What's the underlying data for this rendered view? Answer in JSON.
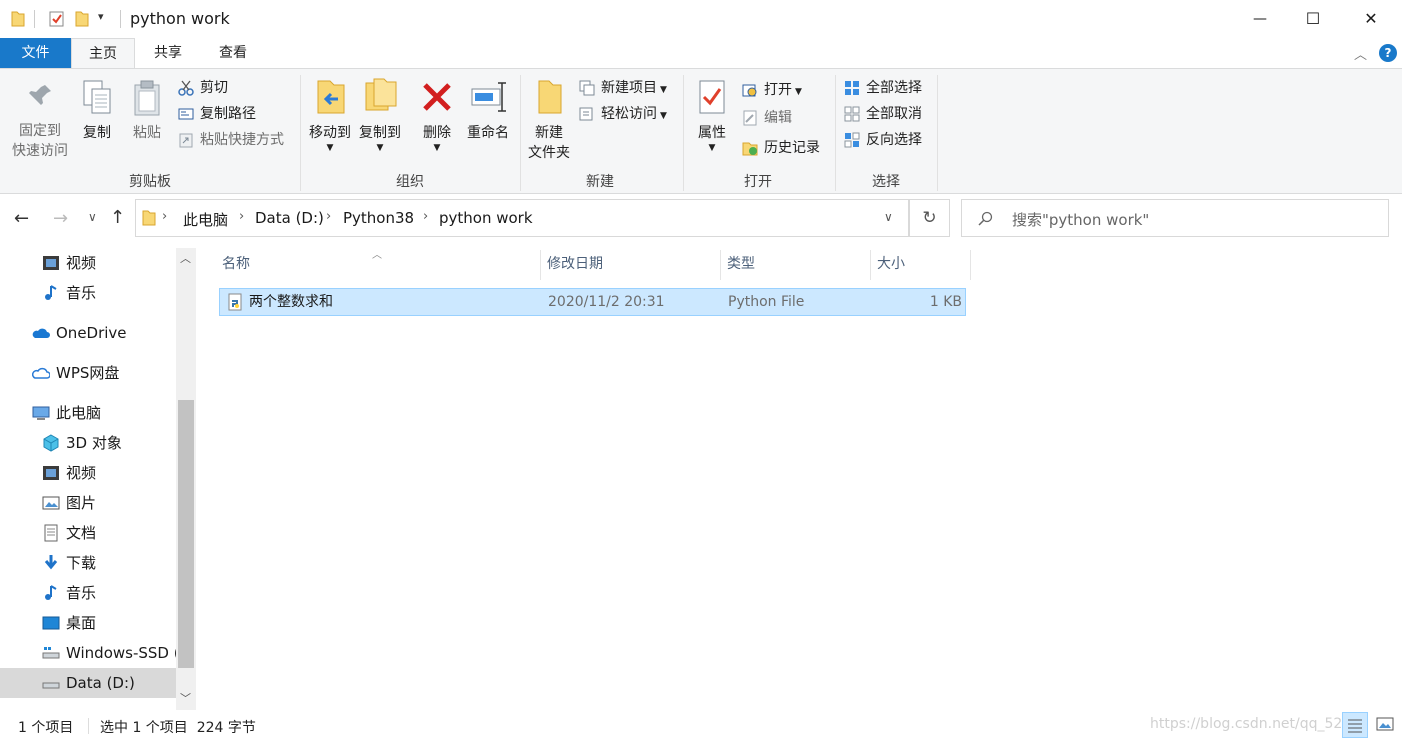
{
  "window": {
    "title": "python work",
    "controls": {
      "minimize": "—",
      "maximize": "☐",
      "close": "✕"
    }
  },
  "ribbon_tabs": [
    "文件",
    "主页",
    "共享",
    "查看"
  ],
  "ribbon": {
    "clipboard": {
      "label": "剪贴板",
      "pin_line1": "固定到",
      "pin_line2": "快速访问",
      "copy": "复制",
      "paste": "粘贴",
      "cut": "剪切",
      "copy_path": "复制路径",
      "paste_shortcut": "粘贴快捷方式"
    },
    "organize": {
      "label": "组织",
      "move_to": "移动到",
      "copy_to": "复制到",
      "delete": "删除",
      "rename": "重命名"
    },
    "new": {
      "label": "新建",
      "new_folder_line1": "新建",
      "new_folder_line2": "文件夹",
      "new_item": "新建项目",
      "easy_access": "轻松访问"
    },
    "open": {
      "label": "打开",
      "properties": "属性",
      "open": "打开",
      "edit": "编辑",
      "history": "历史记录"
    },
    "select": {
      "label": "选择",
      "select_all": "全部选择",
      "select_none": "全部取消",
      "invert": "反向选择"
    }
  },
  "address": {
    "crumbs": [
      "此电脑",
      "Data (D:)",
      "Python38",
      "python work"
    ],
    "search_placeholder": "搜索\"python work\""
  },
  "sidebar": {
    "items": [
      {
        "label": "视频",
        "icon": "video-icon"
      },
      {
        "label": "音乐",
        "icon": "music-icon"
      },
      {
        "label": "OneDrive",
        "icon": "onedrive-icon"
      },
      {
        "label": "WPS网盘",
        "icon": "cloud-icon"
      },
      {
        "label": "此电脑",
        "icon": "computer-icon"
      },
      {
        "label": "3D 对象",
        "icon": "3d-objects-icon"
      },
      {
        "label": "视频",
        "icon": "video-icon"
      },
      {
        "label": "图片",
        "icon": "pictures-icon"
      },
      {
        "label": "文档",
        "icon": "documents-icon"
      },
      {
        "label": "下载",
        "icon": "download-icon"
      },
      {
        "label": "音乐",
        "icon": "music-icon"
      },
      {
        "label": "桌面",
        "icon": "desktop-icon"
      },
      {
        "label": "Windows-SSD (",
        "icon": "drive-icon"
      },
      {
        "label": "Data (D:)",
        "icon": "drive-icon"
      }
    ]
  },
  "columns": [
    "名称",
    "修改日期",
    "类型",
    "大小"
  ],
  "files": [
    {
      "name": "两个整数求和",
      "modified": "2020/11/2 20:31",
      "type": "Python File",
      "size": "1 KB"
    }
  ],
  "status": {
    "count": "1 个项目",
    "selected": "选中 1 个项目  224 字节"
  },
  "watermark": "https://blog.csdn.net/qq_52",
  "colors": {
    "accent": "#1979ca",
    "selection": "#cce8ff",
    "selection_border": "#99d1ff"
  }
}
